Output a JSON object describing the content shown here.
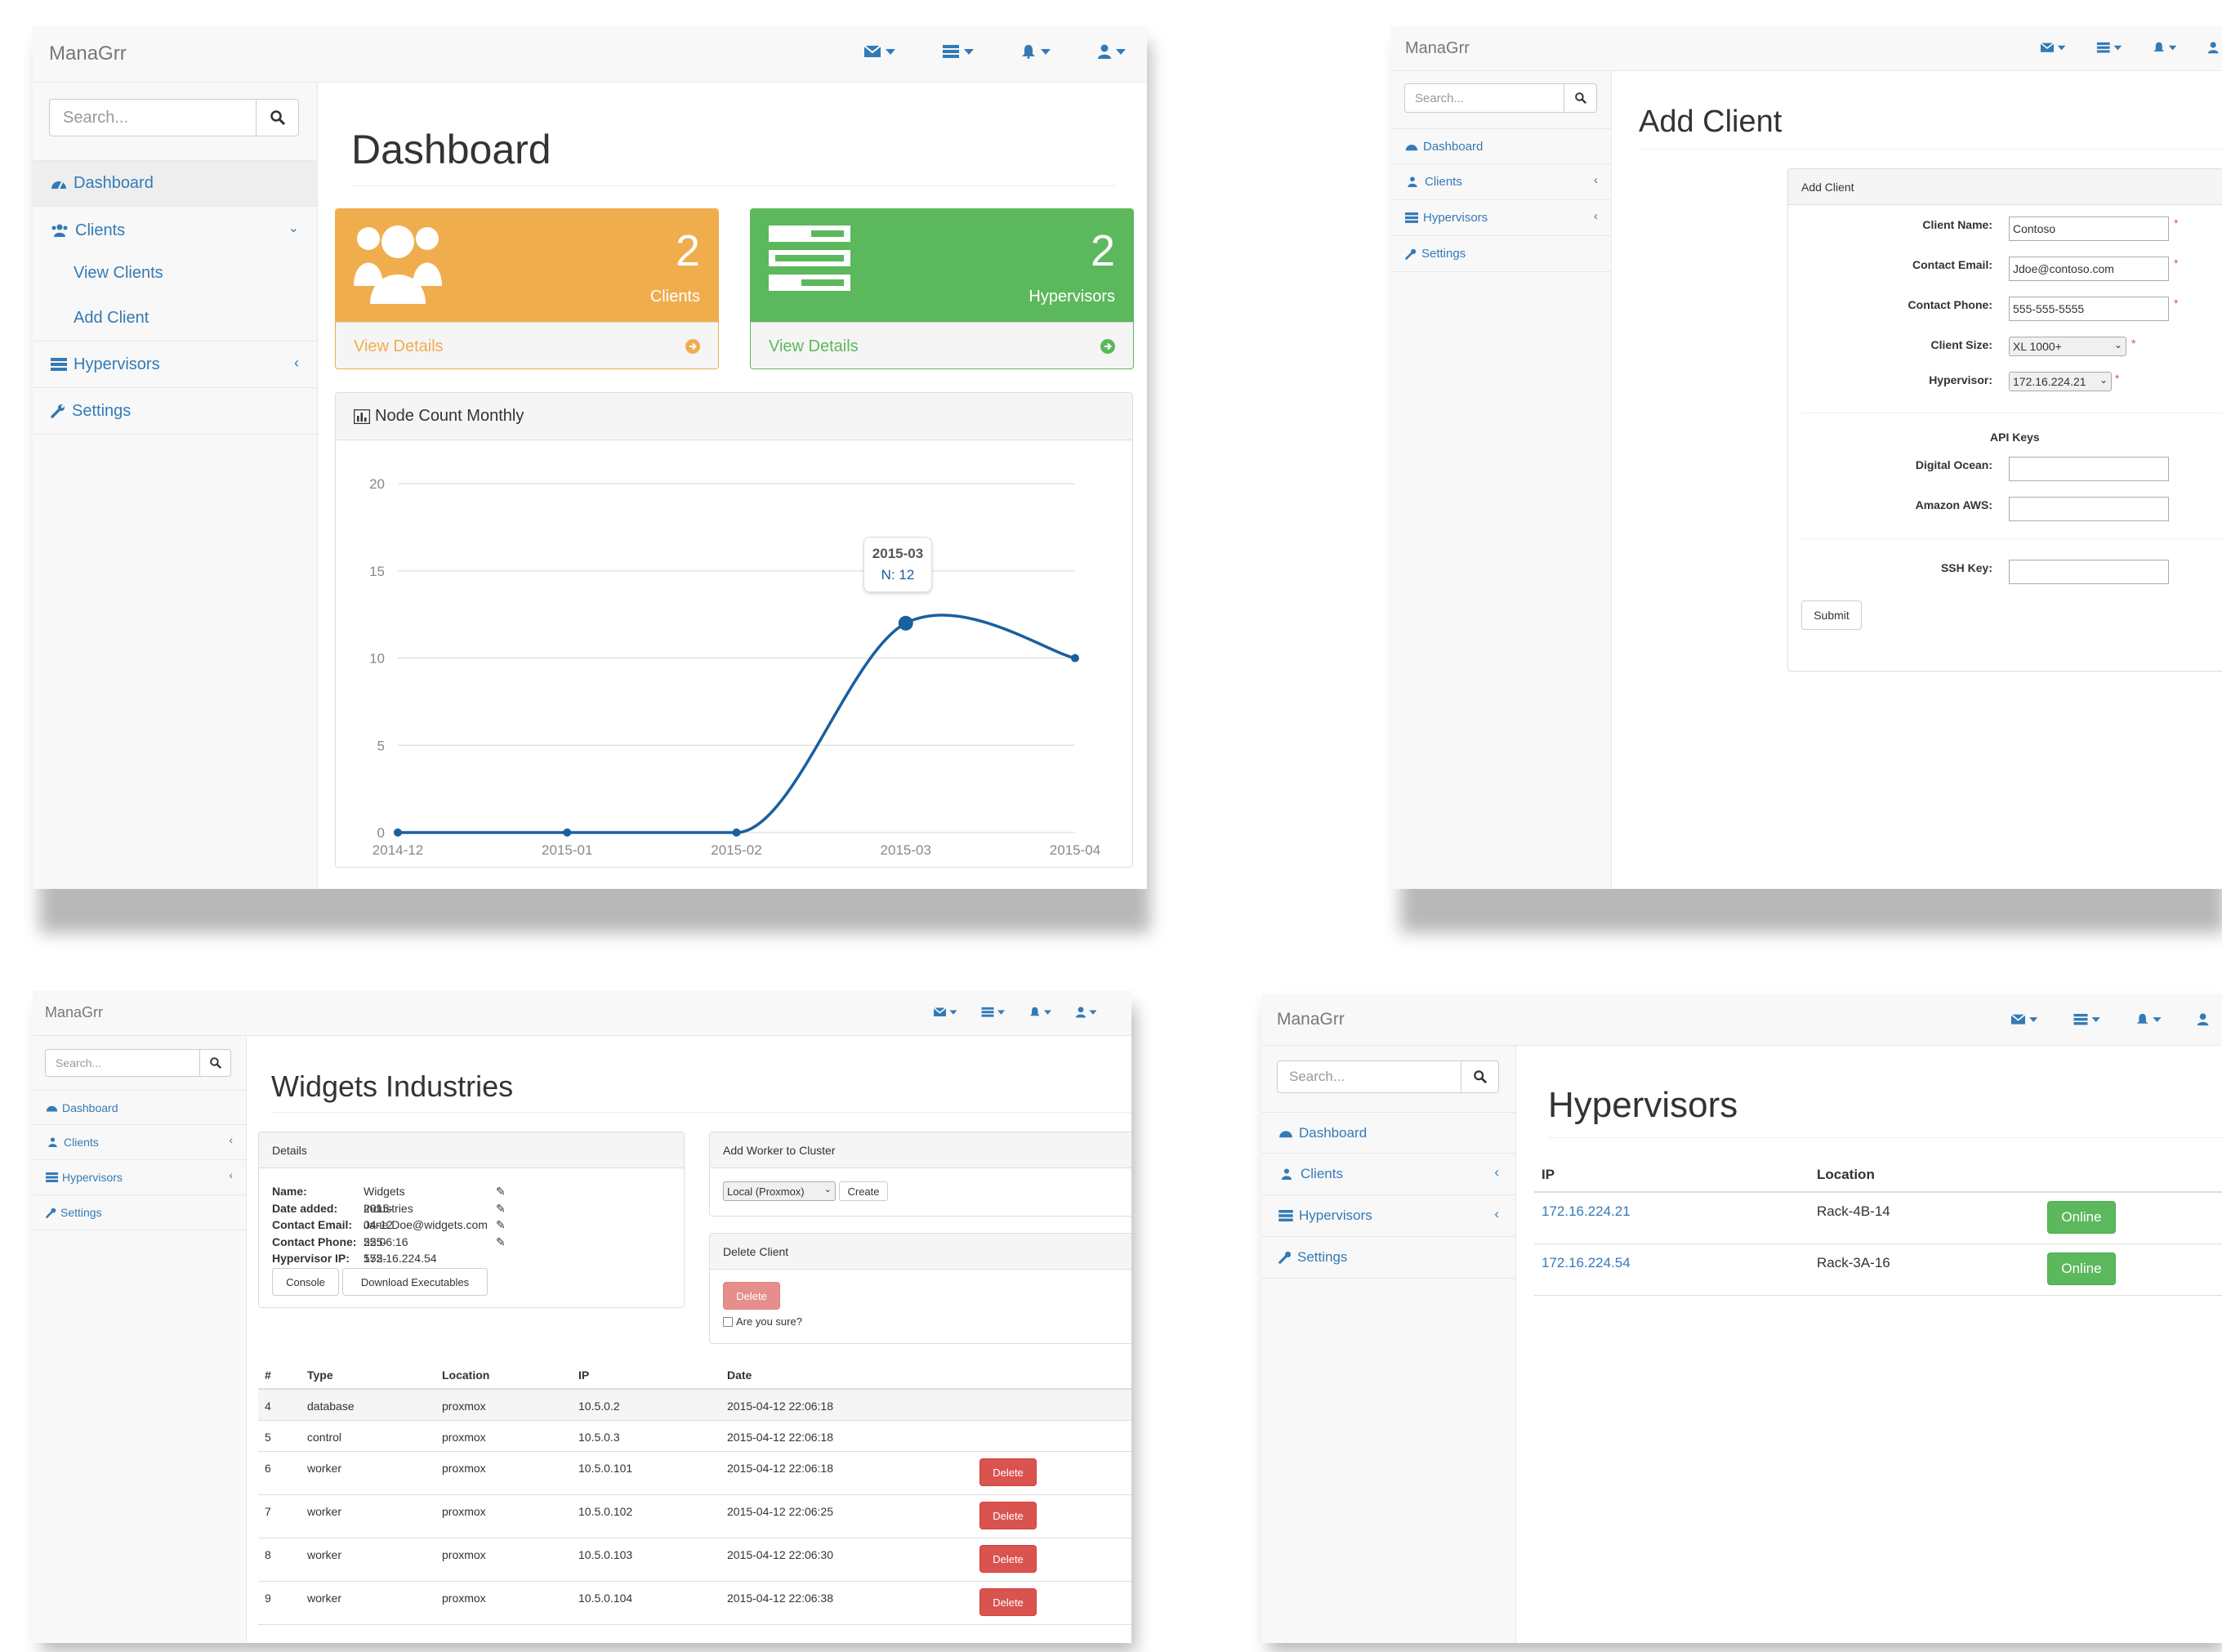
{
  "app": {
    "brand": "ManaGrr",
    "search_placeholder": "Search..."
  },
  "nav_icons": [
    "envelope-icon",
    "tasks-icon",
    "bell-icon",
    "user-icon"
  ],
  "colors": {
    "link": "#337ab7",
    "orange": "#f0ad4e",
    "green": "#5cb85c",
    "danger": "#d9534f",
    "line": "#1a5fa0"
  },
  "sidebar": {
    "dashboard": "Dashboard",
    "clients": "Clients",
    "view_clients": "View Clients",
    "add_client": "Add Client",
    "hypervisors": "Hypervisors",
    "settings": "Settings"
  },
  "dashboard": {
    "title": "Dashboard",
    "clients_card": {
      "count": "2",
      "label": "Clients",
      "link": "View Details"
    },
    "hypervisors_card": {
      "count": "2",
      "label": "Hypervisors",
      "link": "View Details"
    },
    "chart_panel_title": "Node Count Monthly",
    "tooltip": {
      "label": "2015-03",
      "value": "N: 12"
    }
  },
  "chart_data": {
    "type": "line",
    "x": [
      "2014-12",
      "2015-01",
      "2015-02",
      "2015-03",
      "2015-04"
    ],
    "series": [
      {
        "values": [
          0,
          0,
          0,
          12,
          10
        ]
      }
    ],
    "yticks": [
      "0",
      "5",
      "10",
      "15",
      "20"
    ],
    "ylim": [
      0,
      20
    ],
    "grid": true
  },
  "add_client": {
    "title": "Add Client",
    "panel_title": "Add Client",
    "fields": {
      "client_name": {
        "label": "Client Name:",
        "value": "Contoso"
      },
      "contact_email": {
        "label": "Contact Email:",
        "value": "Jdoe@contoso.com"
      },
      "contact_phone": {
        "label": "Contact Phone:",
        "value": "555-555-5555"
      },
      "client_size": {
        "label": "Client Size:",
        "value": "XL 1000+"
      },
      "hypervisor": {
        "label": "Hypervisor:",
        "value": "172.16.224.21"
      }
    },
    "api_keys_title": "API Keys",
    "digital_ocean": "Digital Ocean:",
    "amazon_aws": "Amazon AWS:",
    "ssh_key": "SSH Key:",
    "submit": "Submit"
  },
  "client_detail": {
    "title": "Widgets Industries",
    "details_title": "Details",
    "details": {
      "name": {
        "label": "Name:",
        "value": "Widgets Industries"
      },
      "date_added": {
        "label": "Date added:",
        "value": "2015-04-12 22:06:16"
      },
      "contact_email": {
        "label": "Contact Email:",
        "value": "Jane.Doe@widgets.com"
      },
      "contact_phone": {
        "label": "Contact Phone:",
        "value": "555-555-5555"
      },
      "hypervisor_ip": {
        "label": "Hypervisor IP:",
        "value": "172.16.224.54"
      }
    },
    "console_btn": "Console",
    "download_btn": "Download Executables",
    "add_worker_title": "Add Worker to Cluster",
    "worker_select": "Local (Proxmox)",
    "create_btn": "Create",
    "delete_client_title": "Delete Client",
    "delete_btn": "Delete",
    "are_you_sure": "Are you sure?",
    "table_headers": [
      "#",
      "Type",
      "Location",
      "IP",
      "Date"
    ],
    "rows": [
      {
        "id": "4",
        "type": "database",
        "location": "proxmox",
        "ip": "10.5.0.2",
        "date": "2015-04-12 22:06:18",
        "delete": ""
      },
      {
        "id": "5",
        "type": "control",
        "location": "proxmox",
        "ip": "10.5.0.3",
        "date": "2015-04-12 22:06:18",
        "delete": ""
      },
      {
        "id": "6",
        "type": "worker",
        "location": "proxmox",
        "ip": "10.5.0.101",
        "date": "2015-04-12 22:06:18",
        "delete": "Delete"
      },
      {
        "id": "7",
        "type": "worker",
        "location": "proxmox",
        "ip": "10.5.0.102",
        "date": "2015-04-12 22:06:25",
        "delete": "Delete"
      },
      {
        "id": "8",
        "type": "worker",
        "location": "proxmox",
        "ip": "10.5.0.103",
        "date": "2015-04-12 22:06:30",
        "delete": "Delete"
      },
      {
        "id": "9",
        "type": "worker",
        "location": "proxmox",
        "ip": "10.5.0.104",
        "date": "2015-04-12 22:06:38",
        "delete": "Delete"
      }
    ]
  },
  "hypervisors_page": {
    "title": "Hypervisors",
    "headers": [
      "IP",
      "Location"
    ],
    "rows": [
      {
        "ip": "172.16.224.21",
        "location": "Rack-4B-14",
        "status": "Online"
      },
      {
        "ip": "172.16.224.54",
        "location": "Rack-3A-16",
        "status": "Online"
      }
    ]
  }
}
